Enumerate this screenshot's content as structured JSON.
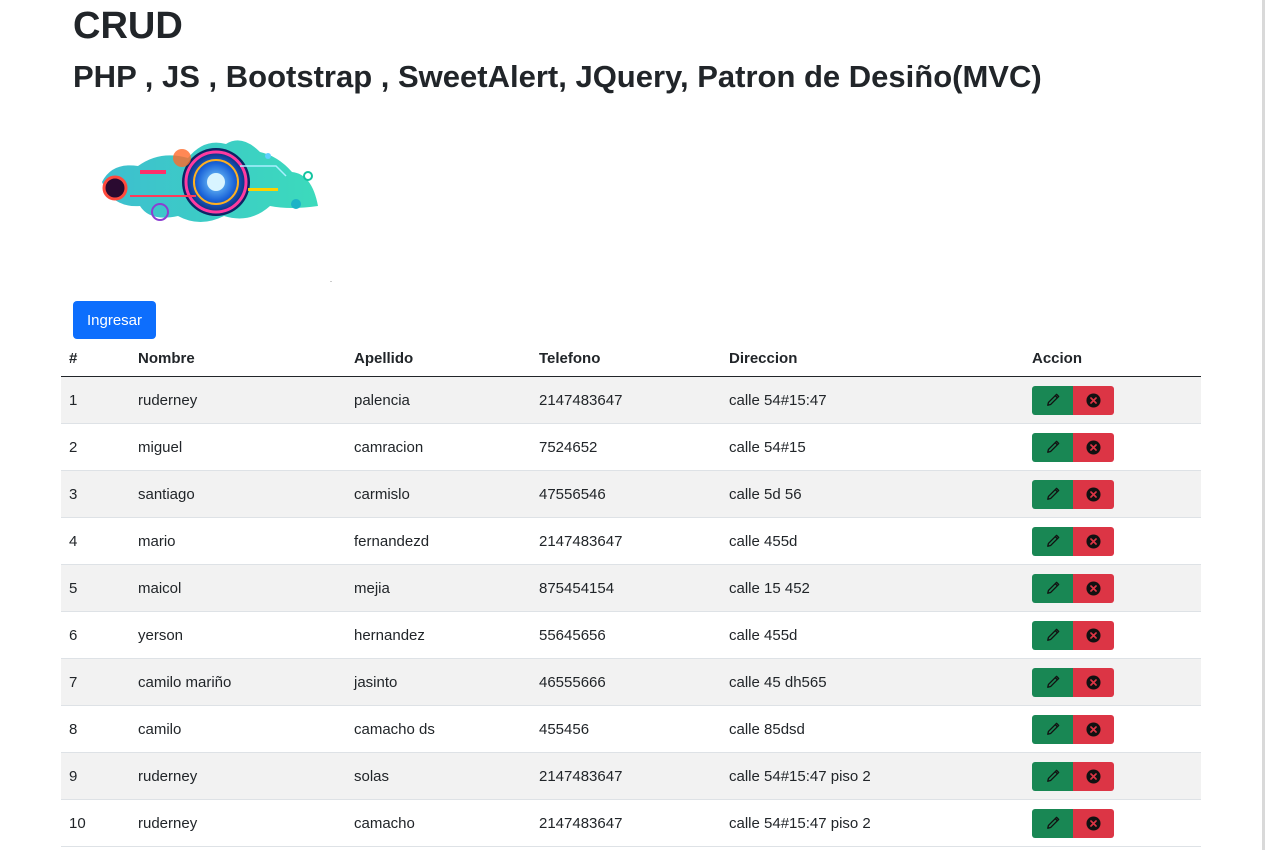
{
  "header": {
    "title": "CRUD",
    "subtitle": "PHP , JS , Bootstrap , SweetAlert, JQuery, Patron de Desiño(MVC)"
  },
  "logo": {
    "icon": "tech-collage-logo"
  },
  "toolbar": {
    "ingresar_label": "Ingresar"
  },
  "table": {
    "columns": [
      "#",
      "Nombre",
      "Apellido",
      "Telefono",
      "Direccion",
      "Accion"
    ],
    "rows": [
      [
        "1",
        "ruderney",
        "palencia",
        "2147483647",
        "calle 54#15:47"
      ],
      [
        "2",
        "miguel",
        "camracion",
        "7524652",
        "calle 54#15"
      ],
      [
        "3",
        "santiago",
        "carmislo",
        "47556546",
        "calle 5d 56"
      ],
      [
        "4",
        "mario",
        "fernandezd",
        "2147483647",
        "calle 455d"
      ],
      [
        "5",
        "maicol",
        "mejia",
        "875454154",
        "calle 15 452"
      ],
      [
        "6",
        "yerson",
        "hernandez",
        "55645656",
        "calle 455d"
      ],
      [
        "7",
        "camilo mariño",
        "jasinto",
        "46555666",
        "calle 45 dh565"
      ],
      [
        "8",
        "camilo",
        "camacho ds",
        "455456",
        "calle 85dsd"
      ],
      [
        "9",
        "ruderney",
        "solas",
        "2147483647",
        "calle 54#15:47 piso 2"
      ],
      [
        "10",
        "ruderney",
        "camacho",
        "2147483647",
        "calle 54#15:47 piso 2"
      ]
    ]
  },
  "colors": {
    "primary": "#0d6efd",
    "edit": "#198754",
    "delete": "#dc3545",
    "stripe": "#f2f2f2"
  },
  "icons": {
    "edit": "pencil-icon",
    "delete": "x-circle-icon"
  }
}
